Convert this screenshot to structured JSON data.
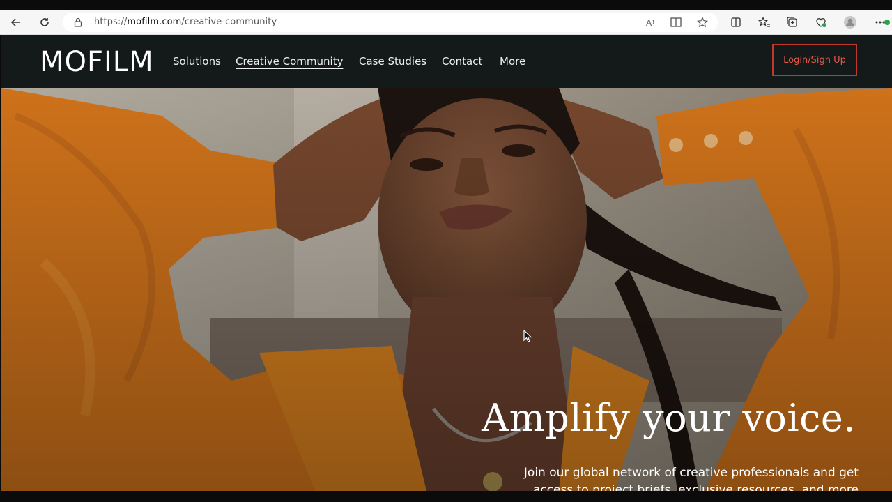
{
  "browser": {
    "url_host": "mofilm.com",
    "url_prefix": "https://",
    "url_path": "/creative-community",
    "icons": [
      "back-icon",
      "reload-icon",
      "lock-icon",
      "read-aloud-icon",
      "immersive-reader-icon",
      "favorite-icon",
      "split-screen-icon",
      "favorites-icon",
      "collections-icon",
      "browser-essentials-icon",
      "profile-icon",
      "more-icon"
    ]
  },
  "nav": {
    "logo": "MOFILM",
    "items": [
      "Solutions",
      "Creative Community",
      "Case Studies",
      "Contact",
      "More"
    ],
    "active": "Creative Community",
    "login_label": "Login/Sign Up"
  },
  "hero": {
    "headline": "Amplify your voice.",
    "subtext": "Join our global network of creative professionals and get access to project briefs, exclusive resources, and more"
  },
  "colors": {
    "nav_bg": "#141a1a",
    "accent": "#c0392b",
    "shirt": "#d9781c"
  }
}
